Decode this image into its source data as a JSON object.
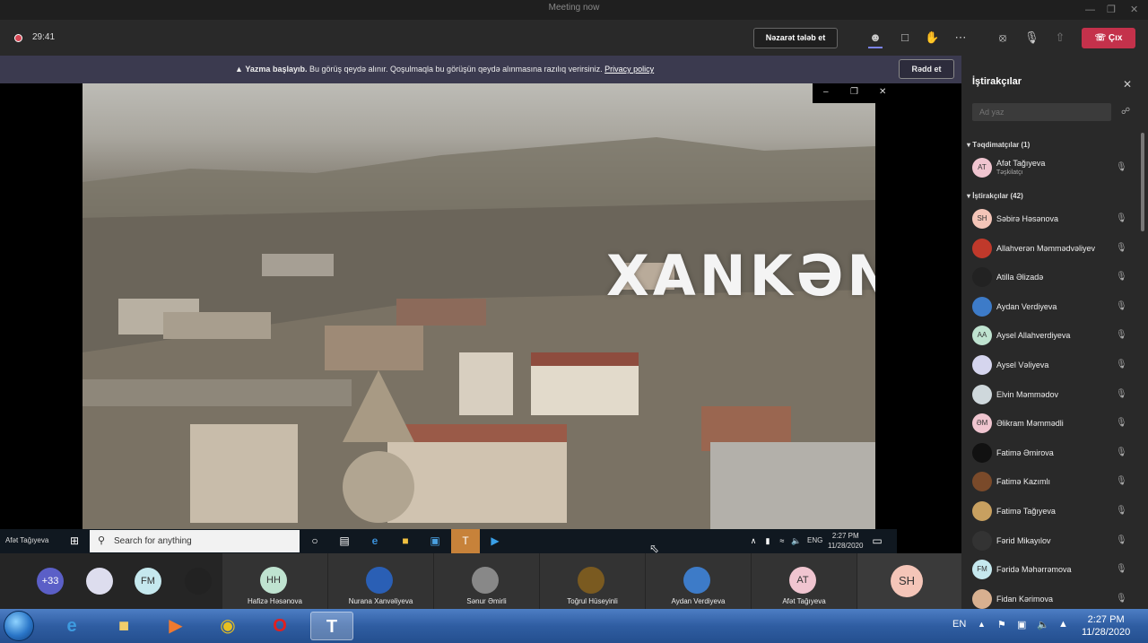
{
  "window": {
    "title": "Meeting now",
    "controls": [
      "—",
      "❐",
      "✕"
    ]
  },
  "toolbar": {
    "timer": "29:41",
    "control_button": "Nəzarət tələb et",
    "leave_button": "Çıx",
    "icons": [
      "participants-icon",
      "chat-icon",
      "raise-hand-icon",
      "more-icon",
      "camera-off-icon",
      "mic-off-icon",
      "share-icon",
      "phone-hangup-icon"
    ]
  },
  "recording_banner": {
    "bold": "Yazma başlayıb.",
    "text": " Bu görüş qeydə alınır. Qoşulmaqla bu görüşün qeydə alınmasına razılıq verirsiniz. ",
    "link": "Privacy policy",
    "dismiss": "Rədd et"
  },
  "shared_screen": {
    "video_title": "XANKƏNDİ",
    "presenter_label": "Afət Tağıyeva",
    "search_placeholder": "Search for anything",
    "clock_time": "2:27 PM",
    "clock_date": "11/28/2020",
    "lang": "ENG"
  },
  "gallery": {
    "overflow_count": "+33",
    "small_avatars": [
      {
        "initials": ""
      },
      {
        "initials": "FM"
      },
      {
        "initials": ""
      }
    ],
    "tiles": [
      {
        "initials": "HH",
        "name": "Hafizə Həsənova"
      },
      {
        "initials": "",
        "name": "Nurana Xanvəliyeva"
      },
      {
        "initials": "",
        "name": "Sənur Əmirli"
      },
      {
        "initials": "",
        "name": "Toğrul Hüseyinli"
      },
      {
        "initials": "",
        "name": "Aydan Verdiyeva"
      },
      {
        "initials": "AT",
        "name": "Afət Tağıyeva"
      }
    ],
    "active_initials": "SH"
  },
  "panel": {
    "title": "İştirakçılar",
    "search_placeholder": "Ad yaz",
    "presenters_header": "Təqdimatçılar (1)",
    "attendees_header": "İştirakçılar (42)",
    "presenter": {
      "initials": "AT",
      "name": "Afət Tağıyeva",
      "role": "Təşkilatçı"
    },
    "attendees": [
      {
        "initials": "SH",
        "name": "Səbirə Həsənova",
        "color": "#f4c5b8"
      },
      {
        "initials": "",
        "name": "Allahverən Məmmədvəliyev",
        "color": "#c0392b"
      },
      {
        "initials": "",
        "name": "Atilla Əlizadə",
        "color": "#222222"
      },
      {
        "initials": "",
        "name": "Aydan Verdiyeva",
        "color": "#3d7bc8"
      },
      {
        "initials": "AA",
        "name": "Aysel Allahverdiyeva",
        "color": "#bfe3d0"
      },
      {
        "initials": "",
        "name": "Aysel Vəliyeva",
        "color": "#d5d5ee"
      },
      {
        "initials": "",
        "name": "Elvin Məmmədov",
        "color": "#cfd8dc"
      },
      {
        "initials": "ƏM",
        "name": "Əlikram Məmmədli",
        "color": "#f0c5d0"
      },
      {
        "initials": "",
        "name": "Fatimə Əmirova",
        "color": "#111111"
      },
      {
        "initials": "",
        "name": "Fatimə Kazımlı",
        "color": "#7a4a2a"
      },
      {
        "initials": "",
        "name": "Fatimə Tağıyeva",
        "color": "#c8a060"
      },
      {
        "initials": "",
        "name": "Fərid Mikayılov",
        "color": "#333333"
      },
      {
        "initials": "FM",
        "name": "Fəridə Məhərrəmova",
        "color": "#c5e8ee"
      },
      {
        "initials": "",
        "name": "Fidan Kərimova",
        "color": "#d8b090"
      }
    ]
  },
  "os_taskbar": {
    "lang": "EN",
    "time": "2:27 PM",
    "date": "11/28/2020"
  }
}
